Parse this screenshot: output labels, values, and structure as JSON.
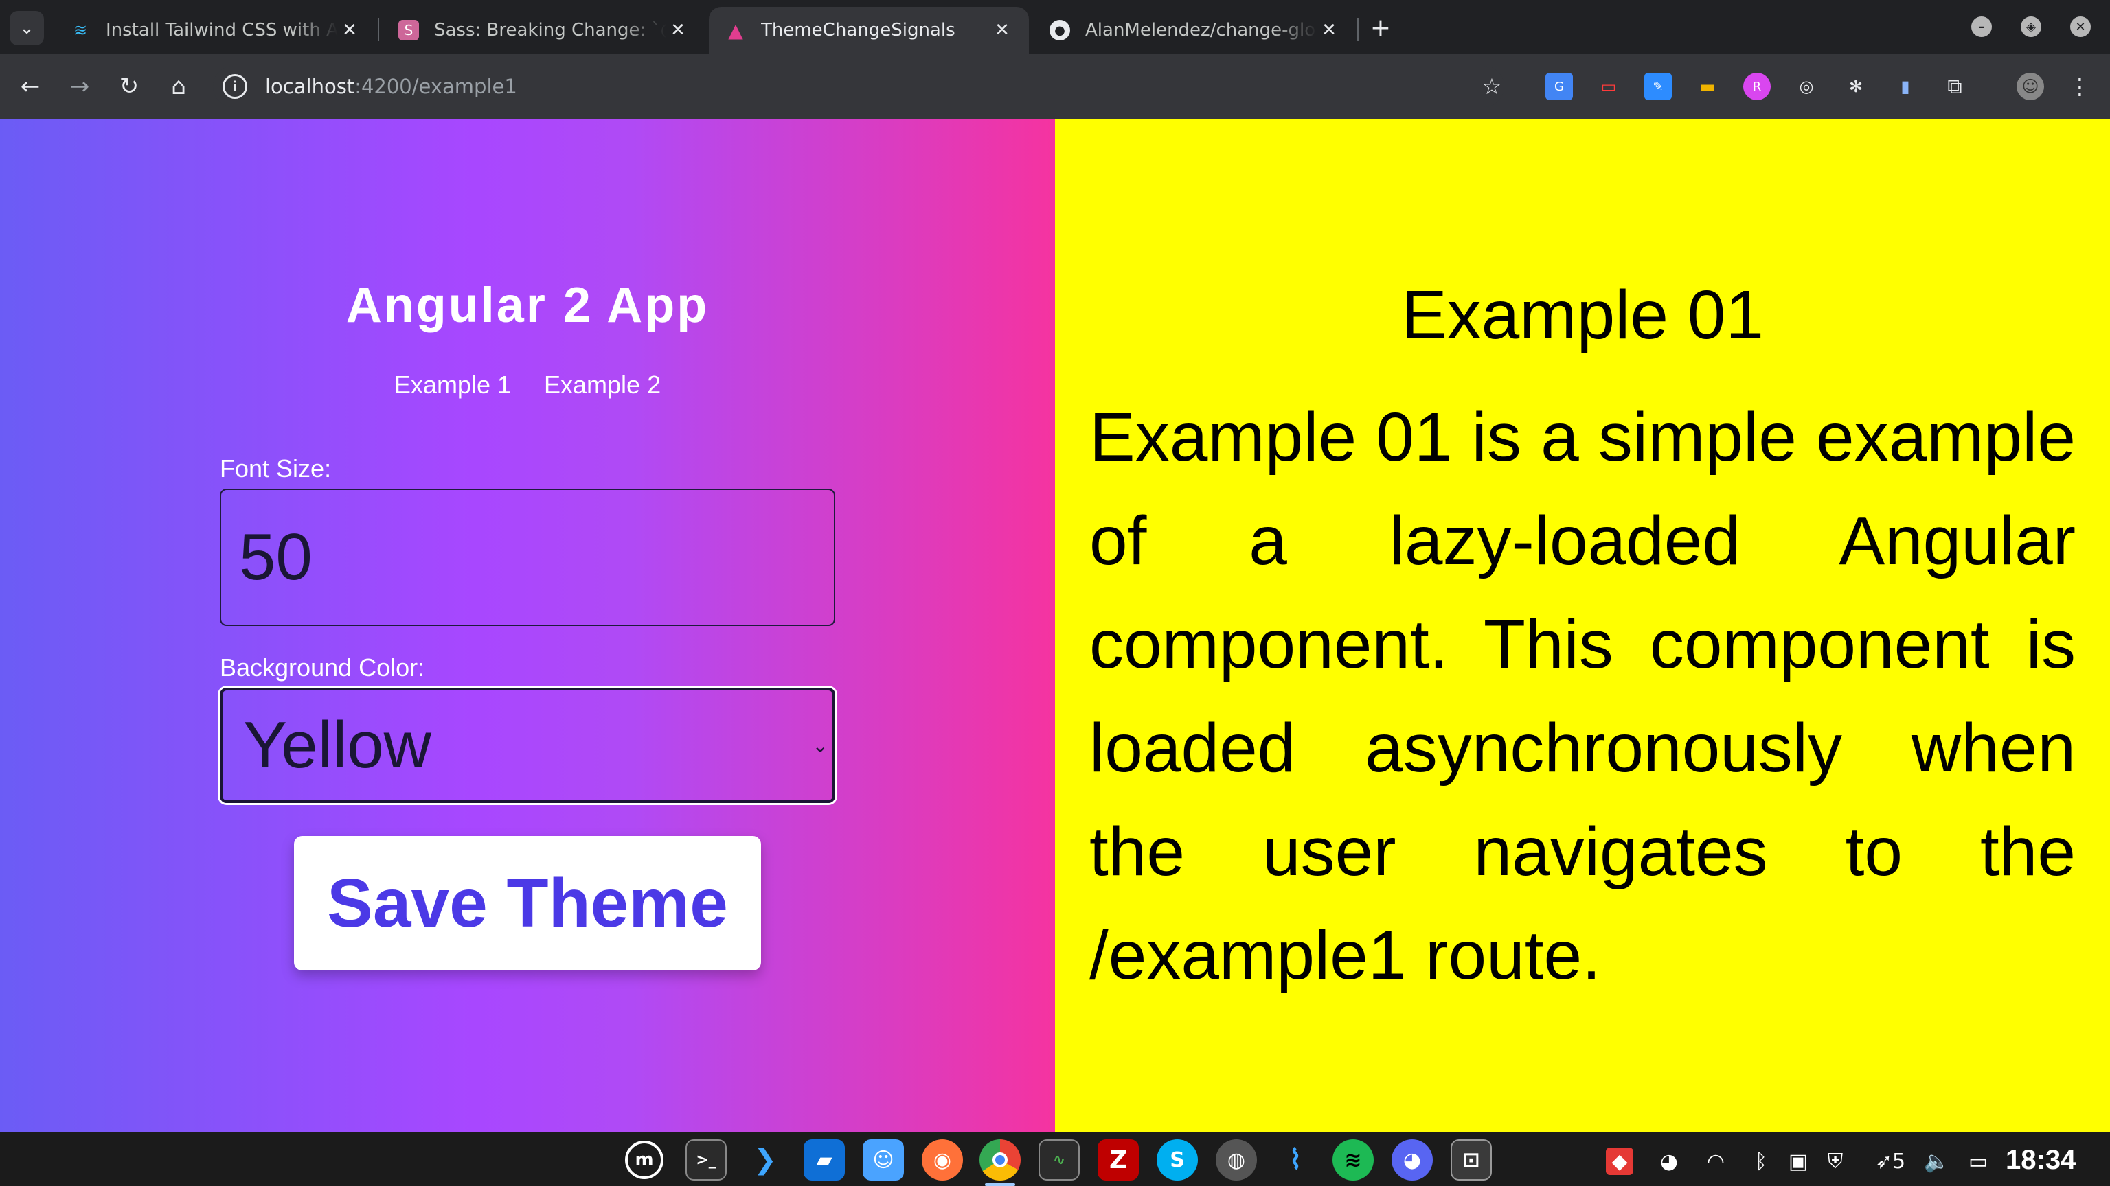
{
  "browser": {
    "tabs": [
      {
        "title": "Install Tailwind CSS with Ang",
        "icon": "tailwind-icon"
      },
      {
        "title": "Sass: Breaking Change: `@im",
        "icon": "sass-icon"
      },
      {
        "title": "ThemeChangeSignals",
        "icon": "angular-icon",
        "active": true
      },
      {
        "title": "AlanMelendez/change-globa",
        "icon": "github-icon"
      }
    ],
    "url_host": "localhost",
    "url_path": ":4200/example1"
  },
  "app": {
    "title": "Angular 2 App",
    "nav": [
      "Example 1",
      "Example 2"
    ],
    "font_size_label": "Font Size:",
    "font_size_value": "50",
    "bg_color_label": "Background Color:",
    "bg_color_value": "Yellow",
    "save_label": "Save Theme"
  },
  "example": {
    "title": "Example 01",
    "body": "Example 01 is a simple example of a lazy-loaded Angular component. This component is loaded asynchronously when the user navigates to the /example1 route."
  },
  "taskbar": {
    "clock": "18:34",
    "battery": "5"
  },
  "colors": {
    "right_bg": "#ffff00",
    "button_text": "#4b39e6",
    "gradient_start": "#6b5cf5",
    "gradient_end": "#f533a0"
  }
}
